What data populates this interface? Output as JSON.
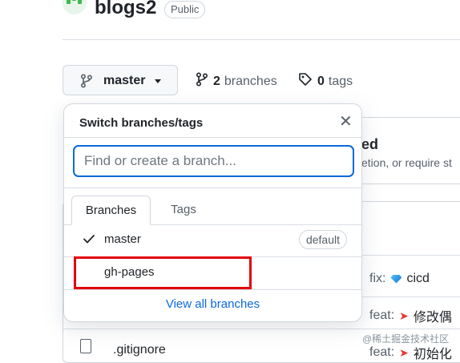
{
  "repo": {
    "name": "blogs2",
    "visibility": "Public"
  },
  "branch_bar": {
    "current_branch": "master",
    "branches_count": "2",
    "branches_label": "branches",
    "tags_count": "0",
    "tags_label": "tags"
  },
  "background": {
    "heading_fragment": "ed",
    "desc_fragment": "etion, or require st",
    "commits": [
      {
        "prefix": "fix:",
        "emoji": "gem-icon",
        "text": "cicd"
      },
      {
        "prefix": "feat:",
        "emoji": "rocket-icon",
        "text": "修改偶"
      },
      {
        "prefix": "feat:",
        "emoji": "rocket-icon",
        "text": "初始化"
      }
    ],
    "file_name": ".gitignore",
    "watermark": "@稀土掘金技术社区"
  },
  "menu": {
    "title": "Switch branches/tags",
    "filter_placeholder": "Find or create a branch...",
    "tabs": [
      {
        "label": "Branches",
        "active": true
      },
      {
        "label": "Tags",
        "active": false
      }
    ],
    "items": [
      {
        "name": "master",
        "selected": true,
        "badge": "default"
      },
      {
        "name": "gh-pages",
        "selected": false,
        "badge": ""
      }
    ],
    "view_all_label": "View all branches"
  },
  "colors": {
    "accent": "#0969da",
    "highlight": "#e3010c",
    "text": "#1f2328",
    "muted": "#57606a",
    "border": "#d0d7de"
  }
}
